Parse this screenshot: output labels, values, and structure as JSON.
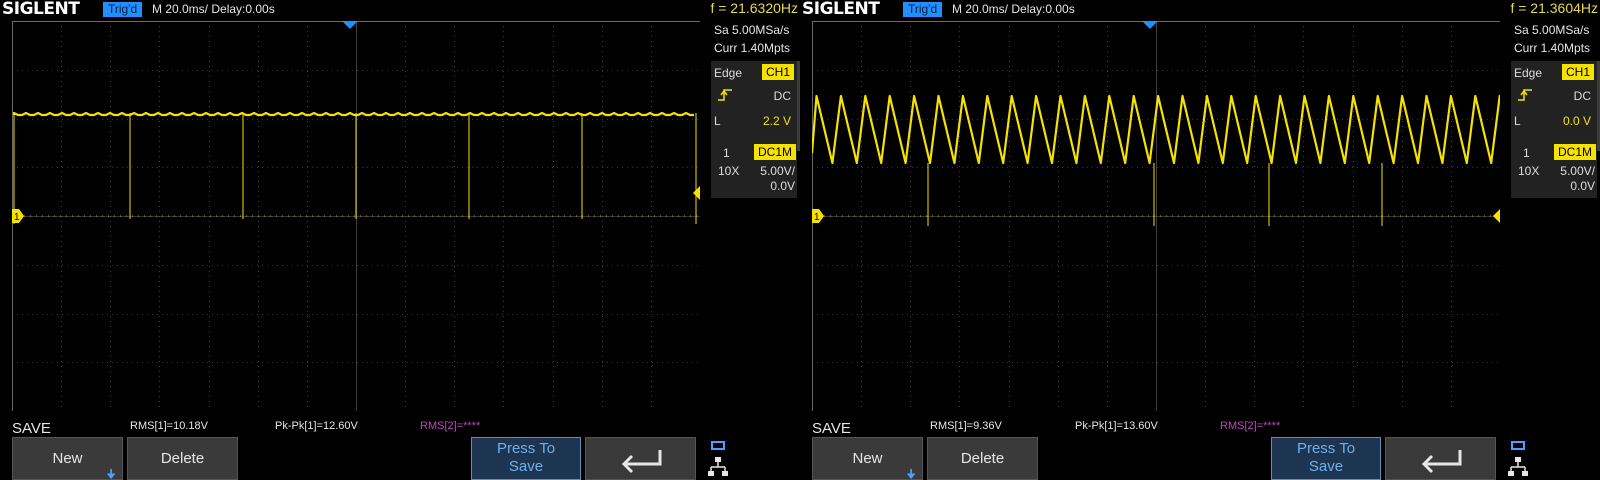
{
  "colors": {
    "trace": "#f5e200",
    "grid": "#6a6a6a",
    "accent": "#1e90ff",
    "meas2": "#c040c0"
  },
  "scopes": [
    {
      "logo": "SIGLENT",
      "trig_status": "Trig'd",
      "timebase": "M 20.0ms/ Delay:0.00s",
      "frequency": "f = 21.6320Hz",
      "sample_rate": "Sa 5.00MSa/s",
      "memory": "Curr 1.40Mpts",
      "trigger": {
        "type": "Edge",
        "source": "CH1",
        "slope_icon": "rising-edge-icon",
        "coupling": "DC",
        "level_label": "L",
        "level": "2.2 V"
      },
      "channel": {
        "number": "1",
        "coupling": "DC1M",
        "probe": "10X",
        "scale": "5.00V/",
        "offset": "0.0V"
      },
      "ground_marker": "1",
      "save_label": "SAVE",
      "measurements": [
        "RMS[1]=10.18V",
        "Pk-Pk[1]=12.60V",
        "RMS[2]=****"
      ],
      "buttons": {
        "new": "New",
        "delete": "Delete",
        "press_l1": "Press To",
        "press_l2": "Save",
        "back_icon": "return-arrow-icon"
      },
      "waveform": "flat"
    },
    {
      "logo": "SIGLENT",
      "trig_status": "Trig'd",
      "timebase": "M 20.0ms/ Delay:0.00s",
      "frequency": "f = 21.3604Hz",
      "sample_rate": "Sa 5.00MSa/s",
      "memory": "Curr 1.40Mpts",
      "trigger": {
        "type": "Edge",
        "source": "CH1",
        "slope_icon": "rising-edge-icon",
        "coupling": "DC",
        "level_label": "L",
        "level": "0.0 V"
      },
      "channel": {
        "number": "1",
        "coupling": "DC1M",
        "probe": "10X",
        "scale": "5.00V/",
        "offset": "0.0V"
      },
      "ground_marker": "1",
      "save_label": "SAVE",
      "measurements": [
        "RMS[1]=9.36V",
        "Pk-Pk[1]=13.60V",
        "RMS[2]=****"
      ],
      "buttons": {
        "new": "New",
        "delete": "Delete",
        "press_l1": "Press To",
        "press_l2": "Save",
        "back_icon": "return-arrow-icon"
      },
      "waveform": "sawtooth"
    }
  ]
}
